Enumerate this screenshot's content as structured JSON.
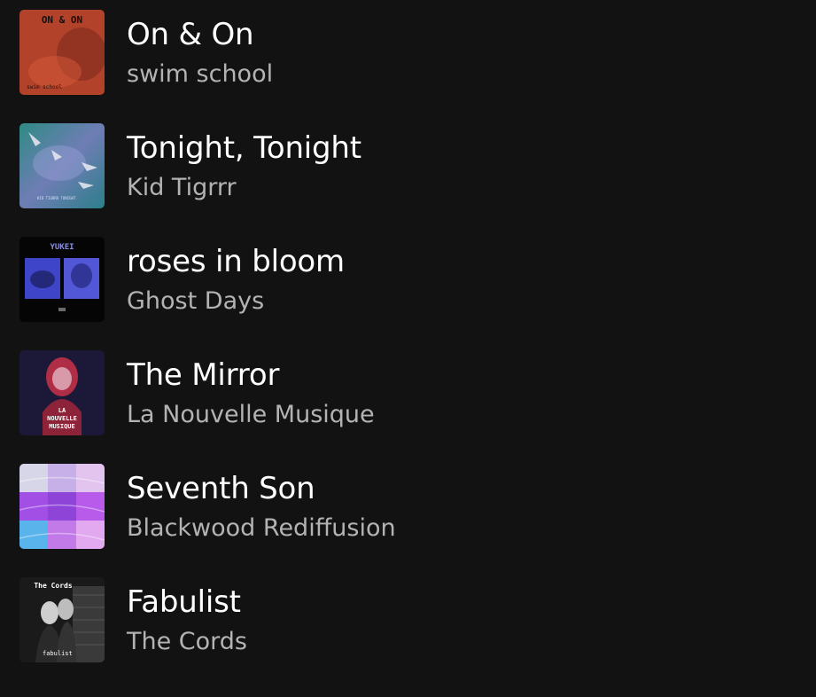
{
  "tracks": [
    {
      "title": "On & On",
      "artist": "swim school",
      "cover_text": [
        "ON & ON",
        "swim school"
      ],
      "cover_colors": [
        "#c4482e",
        "#a83a25"
      ]
    },
    {
      "title": "Tonight, Tonight",
      "artist": "Kid Tigrrr",
      "cover_text": [
        "KID TIGRRR   TONIGHT"
      ],
      "cover_colors": [
        "#2f8c86",
        "#7a7fb8"
      ]
    },
    {
      "title": "roses in bloom",
      "artist": "Ghost Days",
      "cover_text": [
        "YUKEI"
      ],
      "cover_colors": [
        "#000000",
        "#4b4fd6"
      ]
    },
    {
      "title": "The Mirror",
      "artist": "La Nouvelle Musique",
      "cover_text": [
        "LA",
        "NOUVELLE",
        "MUSIQUE"
      ],
      "cover_colors": [
        "#1e1a3c",
        "#c1334a"
      ]
    },
    {
      "title": "Seventh Son",
      "artist": "Blackwood Rediffusion",
      "cover_text": [],
      "cover_colors": [
        "#a050e0",
        "#4fb8e8"
      ]
    },
    {
      "title": "Fabulist",
      "artist": "The Cords",
      "cover_text": [
        "The Cords",
        "fabulist"
      ],
      "cover_colors": [
        "#111111",
        "#cfcfcf"
      ]
    }
  ]
}
